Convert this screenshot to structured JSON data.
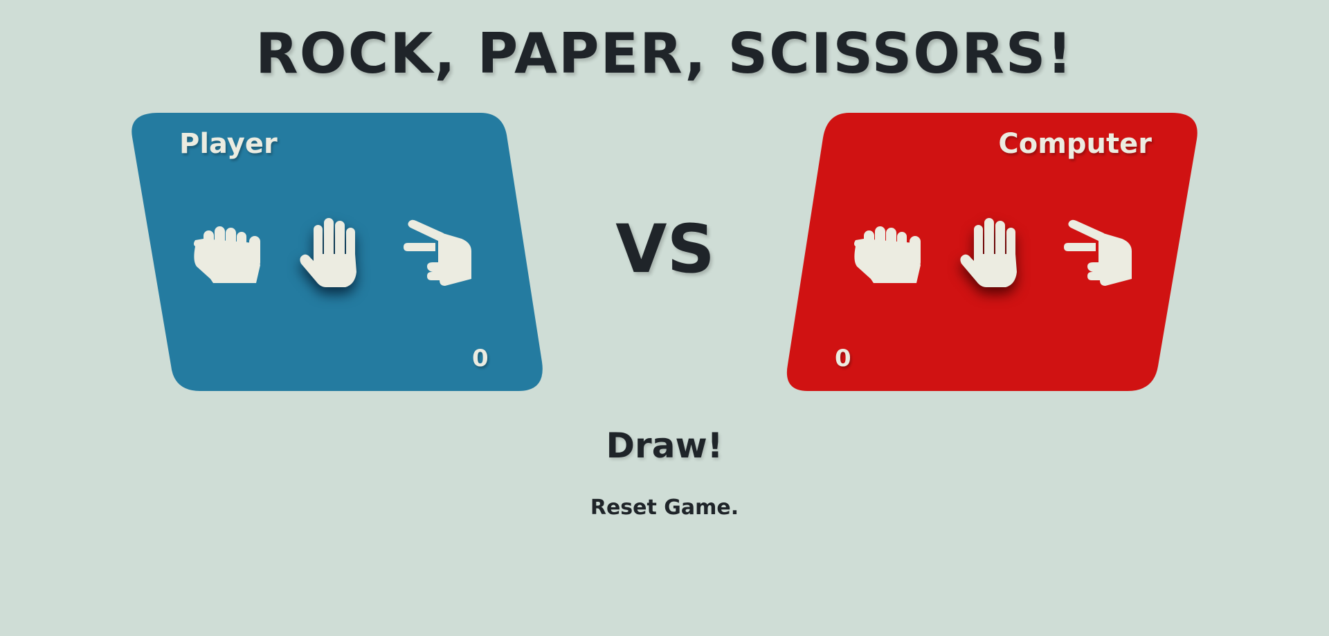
{
  "title": "ROCK, PAPER, SCISSORS!",
  "vs_label": "VS",
  "player": {
    "label": "Player",
    "score": "0",
    "color": "#247ba0",
    "selected": "paper"
  },
  "computer": {
    "label": "Computer",
    "score": "0",
    "color": "#d01212",
    "selected": "paper"
  },
  "choices": [
    "rock",
    "paper",
    "scissors"
  ],
  "icons": {
    "rock": "rock-hand-icon",
    "paper": "paper-hand-icon",
    "scissors": "scissors-hand-icon"
  },
  "result": "Draw!",
  "reset_label": "Reset Game.",
  "colors": {
    "background": "#cfddd6",
    "text": "#1f2429",
    "icon": "#ecece1"
  }
}
